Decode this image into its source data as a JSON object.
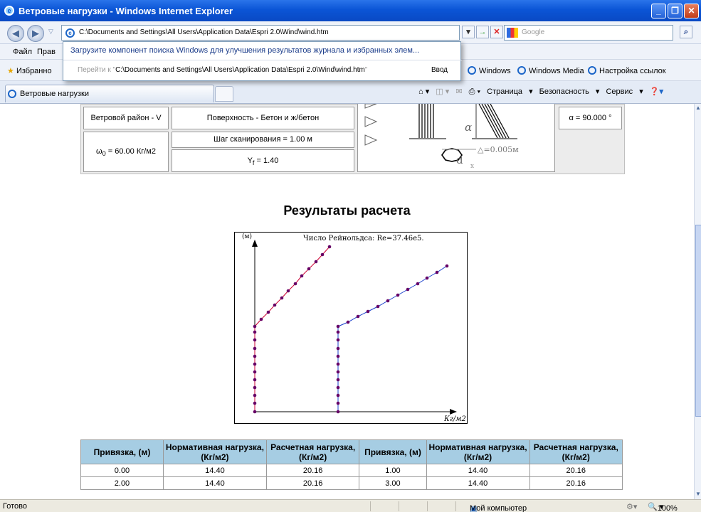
{
  "window": {
    "title": "Ветровые нагрузки - Windows Internet Explorer"
  },
  "address": {
    "url": "C:\\Documents and Settings\\All Users\\Application Data\\Espri 2.0\\Wind\\wind.htm",
    "search_placeholder": "Google"
  },
  "dropdown": {
    "suggestion": "Загрузите компонент поиска Windows для улучшения результатов журнала и избранных элем...",
    "goto_prefix": "Перейти к \"",
    "goto_url": "C:\\Documents and Settings\\All Users\\Application Data\\Espri 2.0\\Wind\\wind.htm",
    "goto_suffix": "\"",
    "enter": "Ввод"
  },
  "menu": {
    "file": "Файл",
    "edit": "Прав"
  },
  "favbar": {
    "favorites": "Избранно",
    "windows": "Windows",
    "media": "Windows Media",
    "links": "Настройка ссылок"
  },
  "tab": {
    "title": "Ветровые нагрузки"
  },
  "commands": {
    "page": "Страница",
    "security": "Безопасность",
    "service": "Сервис"
  },
  "params": {
    "wind_region": "Ветровой район - V",
    "w0_prefix": "ω",
    "w0_sub": "0",
    "w0_suffix": " = 60.00 Кг/м2",
    "surface": "Поверхность - Бетон и ж/бетон",
    "step": "Шаг сканирования = 1.00 м",
    "yf_prefix": "Y",
    "yf_sub": "f",
    "yf_suffix": " = 1.40",
    "alpha_value": "α = 90.000 °",
    "fig_alpha": "α",
    "fig_delta": "△=0.005м",
    "fig_d": "d",
    "fig_x": "x"
  },
  "results": {
    "title": "Результаты расчета",
    "headers": [
      "Привязка, (м)",
      "Нормативная нагрузка, (Кг/м2)",
      "Расчетная нагрузка, (Кг/м2)",
      "Привязка, (м)",
      "Нормативная нагрузка, (Кг/м2)",
      "Расчетная нагрузка, (Кг/м2)"
    ],
    "rows": [
      [
        "0.00",
        "14.40",
        "20.16",
        "1.00",
        "14.40",
        "20.16"
      ],
      [
        "2.00",
        "14.40",
        "20.16",
        "3.00",
        "14.40",
        "20.16"
      ]
    ]
  },
  "chart_data": {
    "type": "line",
    "title": "Число Рейнольдса: Re=37.46e5.",
    "ylabel": "(м)",
    "xlabel": "Кг/м2",
    "colors": {
      "normative": "#cc0033",
      "design": "#1a3fcc",
      "marker": "#660066"
    },
    "series": [
      {
        "values": []
      },
      {
        "values": []
      }
    ]
  },
  "status": {
    "ready": "Готово",
    "computer": "Мой компьютер",
    "zoom": "100%"
  }
}
